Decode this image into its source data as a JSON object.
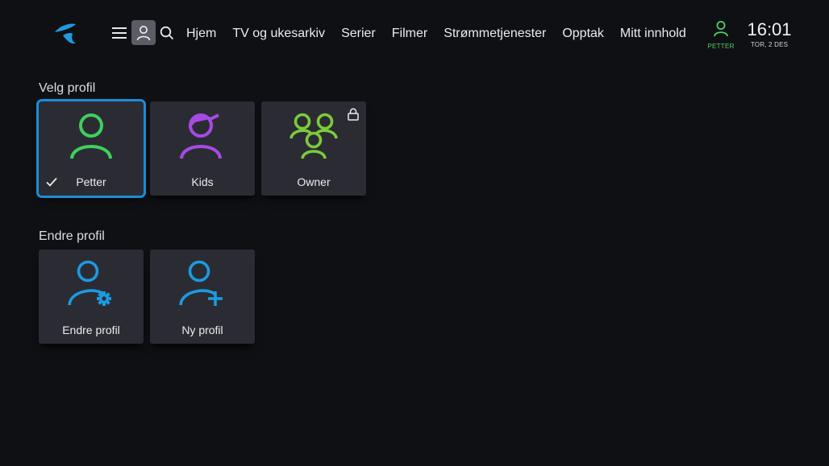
{
  "header": {
    "nav": [
      "Hjem",
      "TV og ukesarkiv",
      "Serier",
      "Filmer",
      "Strømmetjenester",
      "Opptak",
      "Mitt innhold"
    ],
    "user": "PETTER",
    "time": "16:01",
    "date": "TOR, 2 DES"
  },
  "select_profile": {
    "title": "Velg profil",
    "profiles": [
      {
        "label": "Petter",
        "selected": true,
        "icon": "person-icon",
        "color": "#3ecf5c"
      },
      {
        "label": "Kids",
        "selected": false,
        "icon": "kids-person-icon",
        "color": "#a64ae6"
      },
      {
        "label": "Owner",
        "selected": false,
        "icon": "group-icon",
        "color": "#7ccb3a",
        "locked": true
      }
    ]
  },
  "edit_profile": {
    "title": "Endre profil",
    "actions": [
      {
        "label": "Endre profil",
        "icon": "person-settings-icon",
        "color": "#1c9be0"
      },
      {
        "label": "Ny profil",
        "icon": "person-add-icon",
        "color": "#1c9be0"
      }
    ]
  },
  "colors": {
    "background": "#0f1014",
    "tile": "#2b2c33",
    "focus": "#1b8ed6",
    "brand": "#1c9be0"
  }
}
